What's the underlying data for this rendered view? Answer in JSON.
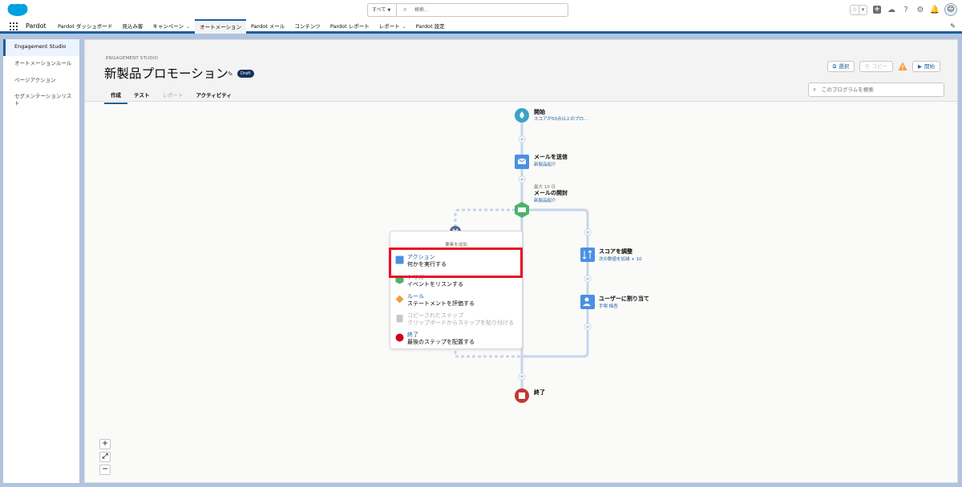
{
  "global_header": {
    "search_scope": "すべて",
    "search_placeholder": "検索..."
  },
  "app_nav": {
    "app_name": "Pardot",
    "items": [
      {
        "label": "Pardot ダッシュボード",
        "dropdown": false
      },
      {
        "label": "見込み客",
        "dropdown": false
      },
      {
        "label": "キャンペーン",
        "dropdown": true
      },
      {
        "label": "オートメーション",
        "dropdown": false,
        "active": true
      },
      {
        "label": "Pardot メール",
        "dropdown": false
      },
      {
        "label": "コンテンツ",
        "dropdown": false
      },
      {
        "label": "Pardot レポート",
        "dropdown": false
      },
      {
        "label": "レポート",
        "dropdown": true
      },
      {
        "label": "Pardot 設定",
        "dropdown": false
      }
    ]
  },
  "sidebar": {
    "items": [
      {
        "label": "Engagement Studio",
        "active": true
      },
      {
        "label": "オートメーションルール"
      },
      {
        "label": "ページアクション"
      },
      {
        "label": "セグメンテーションリスト"
      }
    ]
  },
  "program": {
    "eyebrow": "ENGAGEMENT STUDIO",
    "title": "新製品プロモーション",
    "status": "Draft",
    "tabs": [
      {
        "label": "作成",
        "state": "active"
      },
      {
        "label": "テスト",
        "state": "normal"
      },
      {
        "label": "レポート",
        "state": "disabled"
      },
      {
        "label": "アクティビティ",
        "state": "normal"
      }
    ],
    "buttons": {
      "select": "選択",
      "copy": "コピー",
      "start": "開始"
    },
    "search_placeholder": "このプログラムを検索"
  },
  "flow": {
    "start": {
      "label": "開始",
      "sub": "スコアが50点以上のプロ..."
    },
    "send_email": {
      "label": "メールを送信",
      "sub": "新製品紹介"
    },
    "email_open": {
      "meta": "最大 10 日",
      "label": "メールの開封",
      "sub": "新製品紹介"
    },
    "adjust_score": {
      "label": "スコアを調整",
      "sub": "次の数値を加減 + 10"
    },
    "assign_user": {
      "label": "ユーザーに割り当て",
      "sub": "手塚 梅吾"
    },
    "end": {
      "label": "終了"
    }
  },
  "add_menu": {
    "title": "要素を追加",
    "items": [
      {
        "title": "アクション",
        "desc": "何かを実行する",
        "color": "#4a90e2",
        "shape": "square"
      },
      {
        "title": "トリガー",
        "desc": "イベントをリスンする",
        "color": "#4bb36b",
        "shape": "hexagon"
      },
      {
        "title": "ルール",
        "desc": "ステートメントを評価する",
        "color": "#f0a03c",
        "shape": "diamond"
      },
      {
        "title": "コピーされたステップ",
        "desc": "クリップボードからステップを貼り付ける",
        "color": "#c9c7c5",
        "shape": "clipboard",
        "disabled": true
      },
      {
        "title": "終了",
        "desc": "最後のステップを配置する",
        "color": "#d0021b",
        "shape": "circle"
      }
    ]
  },
  "colors": {
    "brand_blue": "#1b5f9e",
    "start_node": "#3ba3c7",
    "action_node": "#4a90e2",
    "trigger_node": "#4bb36b",
    "end_node": "#c23934",
    "highlight": "#e81123",
    "connector": "#c7d5ea"
  }
}
